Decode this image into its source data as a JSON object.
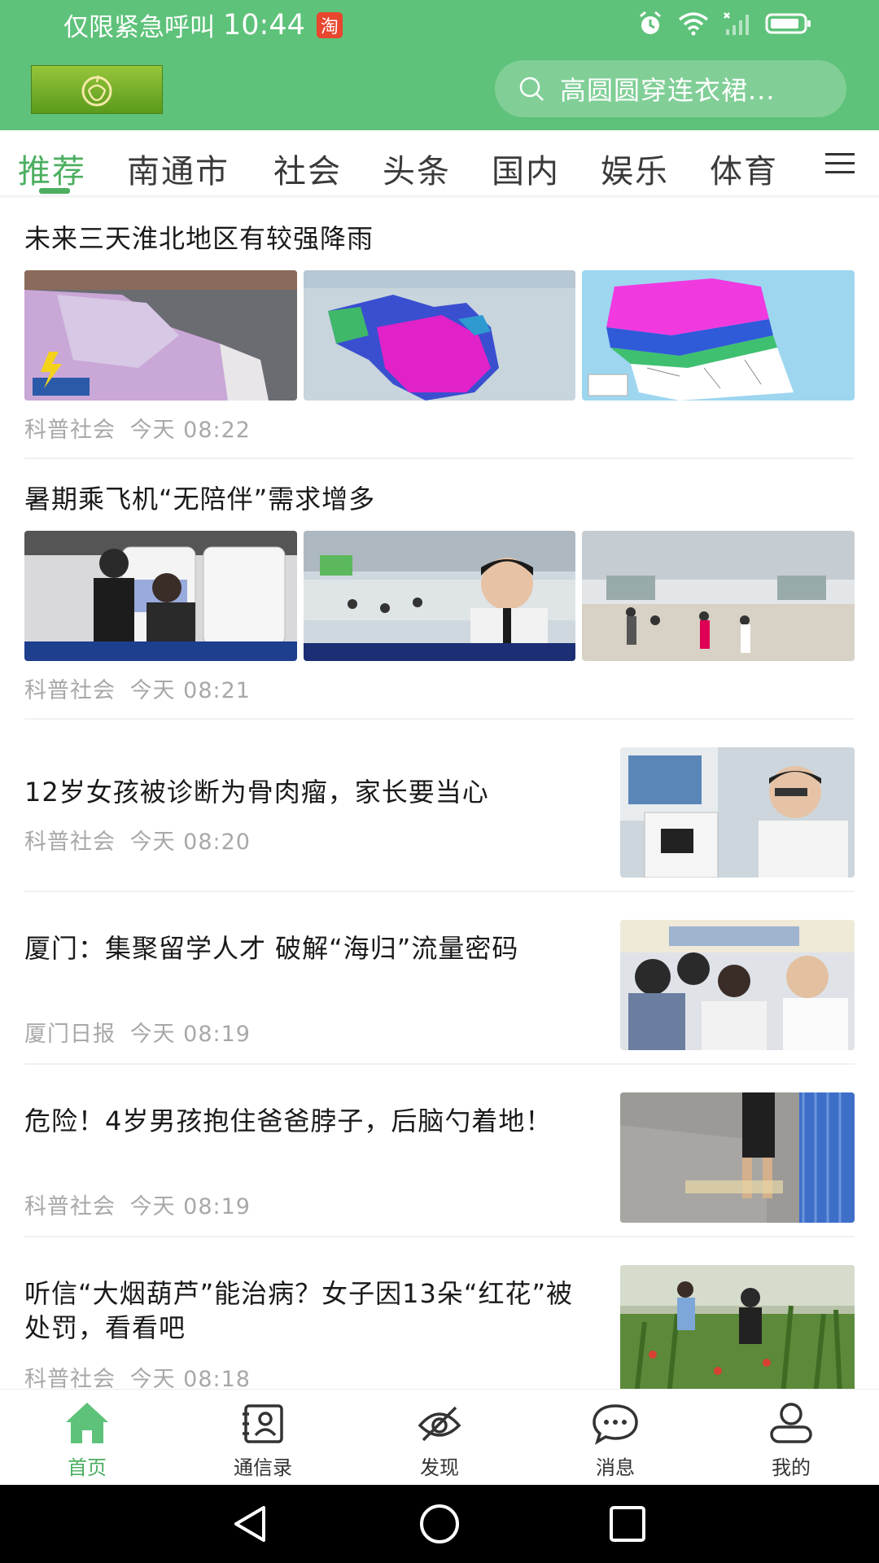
{
  "status_bar": {
    "carrier": "仅限紧急呼叫",
    "time": "10:44",
    "taobao_badge": "淘"
  },
  "search": {
    "placeholder": "高圆圆穿连衣裙..."
  },
  "tabs": [
    {
      "label": "推荐",
      "active": true
    },
    {
      "label": "南通市"
    },
    {
      "label": "社会"
    },
    {
      "label": "头条"
    },
    {
      "label": "国内"
    },
    {
      "label": "娱乐"
    },
    {
      "label": "体育"
    }
  ],
  "feed": [
    {
      "title": "未来三天淮北地区有较强降雨",
      "source": "科普社会",
      "time": "今天 08:22",
      "image_count": 3
    },
    {
      "title": "暑期乘飞机“无陪伴”需求增多",
      "source": "科普社会",
      "time": "今天 08:21",
      "image_count": 3
    },
    {
      "title": "12岁女孩被诊断为骨肉瘤，家长要当心",
      "source": "科普社会",
      "time": "今天 08:20"
    },
    {
      "title": "厦门：集聚留学人才 破解“海归”流量密码",
      "source": "厦门日报",
      "time": "今天 08:19"
    },
    {
      "title": "危险！4岁男孩抱住爸爸脖子，后脑勺着地！",
      "source": "科普社会",
      "time": "今天 08:19"
    },
    {
      "title": "听信“大烟葫芦”能治病？女子因13朵“红花”被处罚，看看吧",
      "source": "科普社会",
      "time": "今天 08:18"
    }
  ],
  "bottom_nav": [
    {
      "label": "首页",
      "icon": "home-icon",
      "active": true
    },
    {
      "label": "通信录",
      "icon": "contacts-icon"
    },
    {
      "label": "发现",
      "icon": "discover-icon"
    },
    {
      "label": "消息",
      "icon": "message-icon"
    },
    {
      "label": "我的",
      "icon": "profile-icon"
    }
  ],
  "colors": {
    "brand_green": "#5ec27a",
    "accent_green": "#4caf60",
    "meta_gray": "#a8a8a8"
  }
}
